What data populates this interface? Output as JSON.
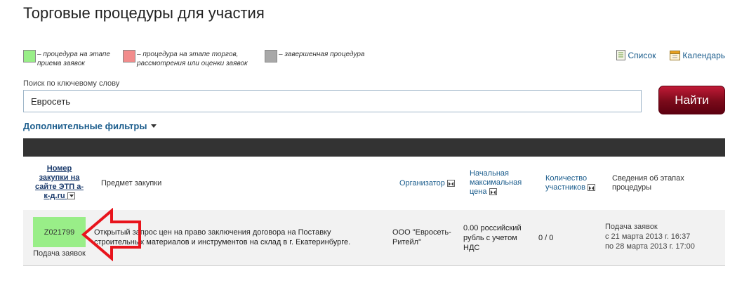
{
  "page": {
    "title": "Торговые процедуры для участия"
  },
  "legend": [
    {
      "line1": "– процедура на этапе",
      "line2": "приема заявок",
      "color": "#99ee88"
    },
    {
      "line1": "– процедура на этапе торгов,",
      "line2": "рассмотрения или оценки заявок",
      "color": "#f28c8c"
    },
    {
      "line1": "– завершенная процедура",
      "line2": "",
      "color": "#a8a8a8"
    }
  ],
  "views": {
    "list": "Список",
    "calendar": "Календарь"
  },
  "search": {
    "label": "Поиск по ключевому слову",
    "value": "Евросеть",
    "button": "Найти"
  },
  "filters": {
    "label": "Дополнительные фильтры"
  },
  "table": {
    "headers": {
      "number": [
        "Номер",
        "закупки на",
        "сайте ЭТП а-",
        "к-д.ru"
      ],
      "subject": "Предмет закупки",
      "organizer": "Организатор",
      "price": [
        "Начальная",
        "максимальная",
        "цена"
      ],
      "participants": [
        "Количество",
        "участников"
      ],
      "stages": [
        "Сведения об этапах",
        "процедуры"
      ]
    },
    "rows": [
      {
        "id": "Z021799",
        "stage": "Подача заявок",
        "subject": [
          "Открытый запрос цен на право заключения договора на Поставку",
          "строительных материалов и инструментов на склад в г. Екатеринбурге."
        ],
        "organizer": [
          "ООО \"Евросеть-",
          "Ритейл\""
        ],
        "price": [
          "0.00 российский",
          "рубль с учетом",
          "НДС"
        ],
        "participants": "0 / 0",
        "stage_info": [
          "Подача заявок",
          "с 21 марта 2013 г. 16:37",
          "по 28 марта 2013 г. 17:00"
        ]
      }
    ]
  },
  "colors": {
    "accent": "#1a5c8c",
    "button": "#8a0c1e",
    "arrow": "#e8141c"
  }
}
